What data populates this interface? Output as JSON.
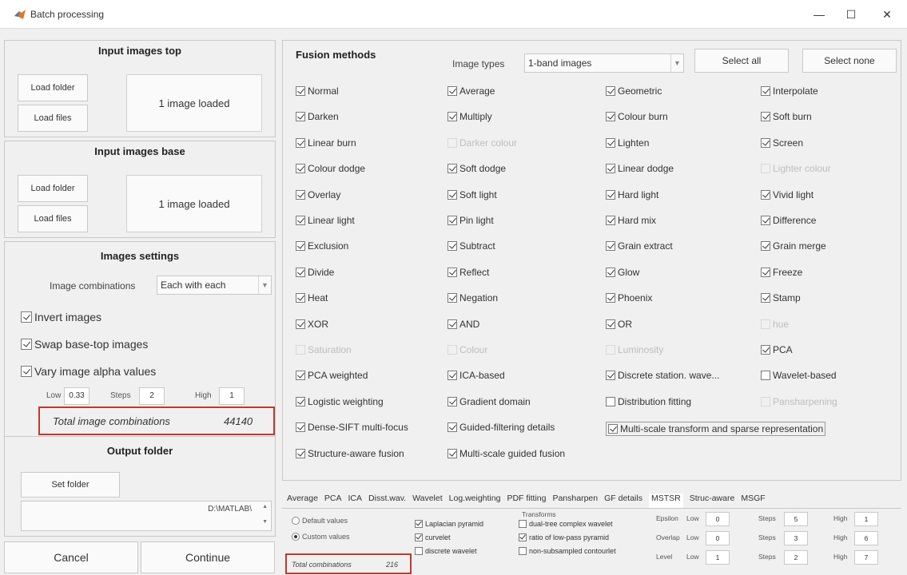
{
  "window": {
    "title": "Batch processing",
    "minimize": "—",
    "maximize": "☐",
    "close": "✕"
  },
  "input_top": {
    "title": "Input images top",
    "load_folder": "Load folder",
    "load_files": "Load files",
    "status": "1 image loaded"
  },
  "input_base": {
    "title": "Input images base",
    "load_folder": "Load folder",
    "load_files": "Load files",
    "status": "1 image loaded"
  },
  "images_settings": {
    "title": "Images settings",
    "combinations_label": "Image combinations",
    "combinations_value": "Each with each",
    "invert": "Invert images",
    "swap": "Swap base-top images",
    "vary_alpha": "Vary image alpha values",
    "low_label": "Low",
    "low_value": "0.33",
    "steps_label": "Steps",
    "steps_value": "2",
    "high_label": "High",
    "high_value": "1",
    "total_label": "Total image combinations",
    "total_value": "44140"
  },
  "output": {
    "title": "Output folder",
    "set_folder": "Set folder",
    "path": "D:\\MATLAB\\"
  },
  "actions": {
    "cancel": "Cancel",
    "continue": "Continue"
  },
  "fusion": {
    "title": "Fusion methods",
    "image_types_label": "Image types",
    "image_types_value": "1-band images",
    "select_all": "Select all",
    "select_none": "Select none",
    "methods": [
      [
        {
          "label": "Normal",
          "checked": true,
          "enabled": true
        },
        {
          "label": "Average",
          "checked": true,
          "enabled": true
        },
        {
          "label": "Geometric",
          "checked": true,
          "enabled": true
        },
        {
          "label": "Interpolate",
          "checked": true,
          "enabled": true
        }
      ],
      [
        {
          "label": "Darken",
          "checked": true,
          "enabled": true
        },
        {
          "label": "Multiply",
          "checked": true,
          "enabled": true
        },
        {
          "label": "Colour burn",
          "checked": true,
          "enabled": true
        },
        {
          "label": "Soft burn",
          "checked": true,
          "enabled": true
        }
      ],
      [
        {
          "label": "Linear burn",
          "checked": true,
          "enabled": true
        },
        {
          "label": "Darker colour",
          "checked": false,
          "enabled": false
        },
        {
          "label": "Lighten",
          "checked": true,
          "enabled": true
        },
        {
          "label": "Screen",
          "checked": true,
          "enabled": true
        }
      ],
      [
        {
          "label": "Colour dodge",
          "checked": true,
          "enabled": true
        },
        {
          "label": "Soft dodge",
          "checked": true,
          "enabled": true
        },
        {
          "label": "Linear dodge",
          "checked": true,
          "enabled": true
        },
        {
          "label": "Lighter colour",
          "checked": false,
          "enabled": false
        }
      ],
      [
        {
          "label": "Overlay",
          "checked": true,
          "enabled": true
        },
        {
          "label": "Soft light",
          "checked": true,
          "enabled": true
        },
        {
          "label": "Hard light",
          "checked": true,
          "enabled": true
        },
        {
          "label": "Vivid light",
          "checked": true,
          "enabled": true
        }
      ],
      [
        {
          "label": "Linear light",
          "checked": true,
          "enabled": true
        },
        {
          "label": "Pin light",
          "checked": true,
          "enabled": true
        },
        {
          "label": "Hard mix",
          "checked": true,
          "enabled": true
        },
        {
          "label": "Difference",
          "checked": true,
          "enabled": true
        }
      ],
      [
        {
          "label": "Exclusion",
          "checked": true,
          "enabled": true
        },
        {
          "label": "Subtract",
          "checked": true,
          "enabled": true
        },
        {
          "label": "Grain extract",
          "checked": true,
          "enabled": true
        },
        {
          "label": "Grain merge",
          "checked": true,
          "enabled": true
        }
      ],
      [
        {
          "label": "Divide",
          "checked": true,
          "enabled": true
        },
        {
          "label": "Reflect",
          "checked": true,
          "enabled": true
        },
        {
          "label": "Glow",
          "checked": true,
          "enabled": true
        },
        {
          "label": "Freeze",
          "checked": true,
          "enabled": true
        }
      ],
      [
        {
          "label": "Heat",
          "checked": true,
          "enabled": true
        },
        {
          "label": "Negation",
          "checked": true,
          "enabled": true
        },
        {
          "label": "Phoenix",
          "checked": true,
          "enabled": true
        },
        {
          "label": "Stamp",
          "checked": true,
          "enabled": true
        }
      ],
      [
        {
          "label": "XOR",
          "checked": true,
          "enabled": true
        },
        {
          "label": "AND",
          "checked": true,
          "enabled": true
        },
        {
          "label": "OR",
          "checked": true,
          "enabled": true
        },
        {
          "label": "hue",
          "checked": false,
          "enabled": false
        }
      ],
      [
        {
          "label": "Saturation",
          "checked": false,
          "enabled": false
        },
        {
          "label": "Colour",
          "checked": false,
          "enabled": false
        },
        {
          "label": "Luminosity",
          "checked": false,
          "enabled": false
        },
        {
          "label": "PCA",
          "checked": true,
          "enabled": true
        }
      ],
      [
        {
          "label": "PCA weighted",
          "checked": true,
          "enabled": true
        },
        {
          "label": "ICA-based",
          "checked": true,
          "enabled": true
        },
        {
          "label": "Discrete station. wave...",
          "checked": true,
          "enabled": true
        },
        {
          "label": "Wavelet-based",
          "checked": false,
          "enabled": true
        }
      ],
      [
        {
          "label": "Logistic weighting",
          "checked": true,
          "enabled": true
        },
        {
          "label": "Gradient domain",
          "checked": true,
          "enabled": true
        },
        {
          "label": "Distribution fitting",
          "checked": false,
          "enabled": true
        },
        {
          "label": "Pansharpening",
          "checked": false,
          "enabled": false
        }
      ],
      [
        {
          "label": "Dense-SIFT multi-focus",
          "checked": true,
          "enabled": true
        },
        {
          "label": "Guided-filtering details",
          "checked": true,
          "enabled": true
        },
        {
          "label": "Multi-scale transform and sparse representation",
          "checked": true,
          "enabled": true
        }
      ],
      [
        {
          "label": "Structure-aware fusion",
          "checked": true,
          "enabled": true
        },
        {
          "label": "Multi-scale guided fusion",
          "checked": true,
          "enabled": true
        }
      ]
    ]
  },
  "tabs": [
    "Average",
    "PCA",
    "ICA",
    "Disst.wav.",
    "Wavelet",
    "Log.weighting",
    "PDF fitting",
    "Pansharpen",
    "GF details",
    "MSTSR",
    "Struc-aware",
    "MSGF"
  ],
  "active_tab": "MSTSR",
  "mstsr": {
    "default_values": "Default values",
    "custom_values": "Custom values",
    "total_label": "Total combinations",
    "total_value": "216",
    "transforms_title": "Transforms",
    "transforms": [
      {
        "label": "Laplacian pyramid",
        "checked": true
      },
      {
        "label": "dual-tree complex wavelet",
        "checked": false
      },
      {
        "label": "curvelet",
        "checked": true
      },
      {
        "label": "ratio of low-pass pyramid",
        "checked": true
      },
      {
        "label": "discrete wavelet",
        "checked": false
      },
      {
        "label": "non-subsampled contourlet",
        "checked": false
      }
    ],
    "params": [
      {
        "name": "Epsilon",
        "low": "0",
        "steps": "5",
        "high": "1"
      },
      {
        "name": "Overlap",
        "low": "0",
        "steps": "3",
        "high": "6"
      },
      {
        "name": "Level",
        "low": "1",
        "steps": "2",
        "high": "7"
      }
    ],
    "low_label": "Low",
    "steps_label": "Steps",
    "high_label": "High"
  }
}
